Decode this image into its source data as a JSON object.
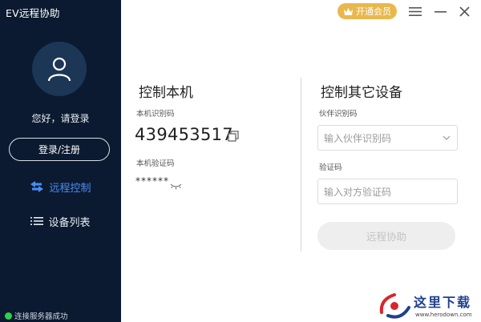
{
  "app": {
    "title": "EV远程协助"
  },
  "sidebar": {
    "greeting": "您好，请登录",
    "login_label": "登录/注册",
    "nav": [
      {
        "label": "远程控制",
        "icon": "swap-arrows-icon",
        "active": true
      },
      {
        "label": "设备列表",
        "icon": "list-icon",
        "active": false
      }
    ],
    "status": "连接服务器成功"
  },
  "header": {
    "vip_label": "开通会员",
    "vip_icon": "crown-icon",
    "menu_icon": "hamburger-icon",
    "minimize_icon": "minimize-icon",
    "close_icon": "close-icon"
  },
  "local": {
    "title": "控制本机",
    "id_label": "本机识别码",
    "id_value": "439453517",
    "pwd_label": "本机验证码",
    "pwd_value": "******"
  },
  "remote": {
    "title": "控制其它设备",
    "partner_label": "伙伴识别码",
    "partner_placeholder": "输入伙伴识别码",
    "code_label": "验证码",
    "code_placeholder": "输入对方验证码",
    "connect_label": "远程协助"
  },
  "watermark": {
    "text": "这里下载",
    "url": "www.herodown.com"
  },
  "colors": {
    "sidebar_bg": "#0b1a30",
    "accent": "#4b8df5",
    "vip": "#e9b84d",
    "status_ok": "#2fd04d"
  }
}
